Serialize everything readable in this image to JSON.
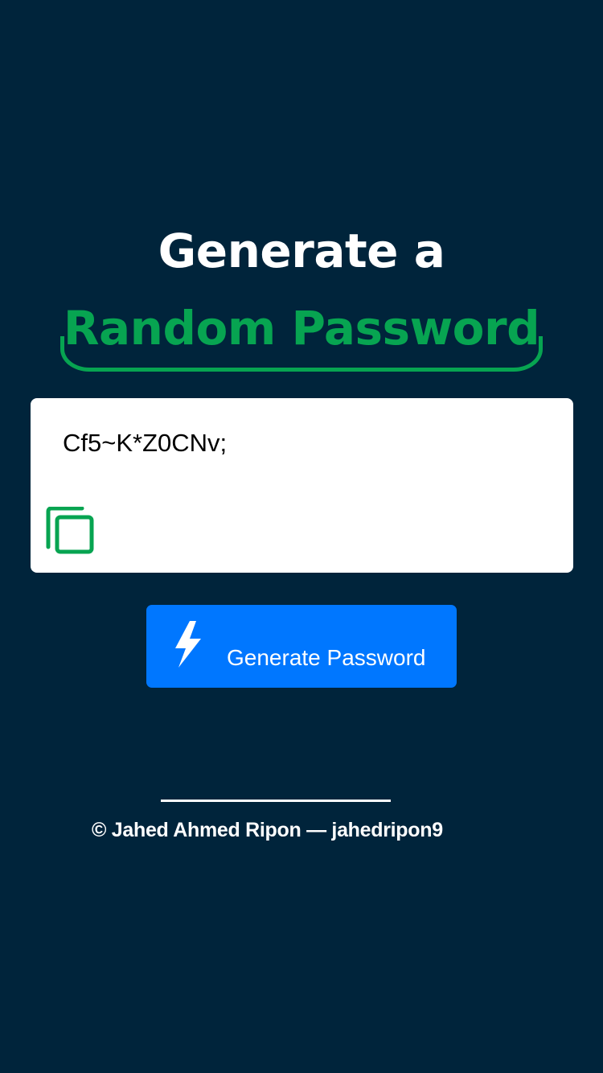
{
  "title": {
    "line1": "Generate a",
    "line2": "Random Password"
  },
  "password": {
    "value": "Cf5~K*Z0CNv;",
    "copy_icon": "copy-icon"
  },
  "generate_button": {
    "label": "Generate Password",
    "icon": "lightning-bolt-icon"
  },
  "footer": {
    "text": "© Jahed Ahmed Ripon — jahedripon9"
  },
  "colors": {
    "background": "#00243b",
    "accent_green": "#07a451",
    "button_blue": "#0077ff",
    "white": "#ffffff"
  }
}
